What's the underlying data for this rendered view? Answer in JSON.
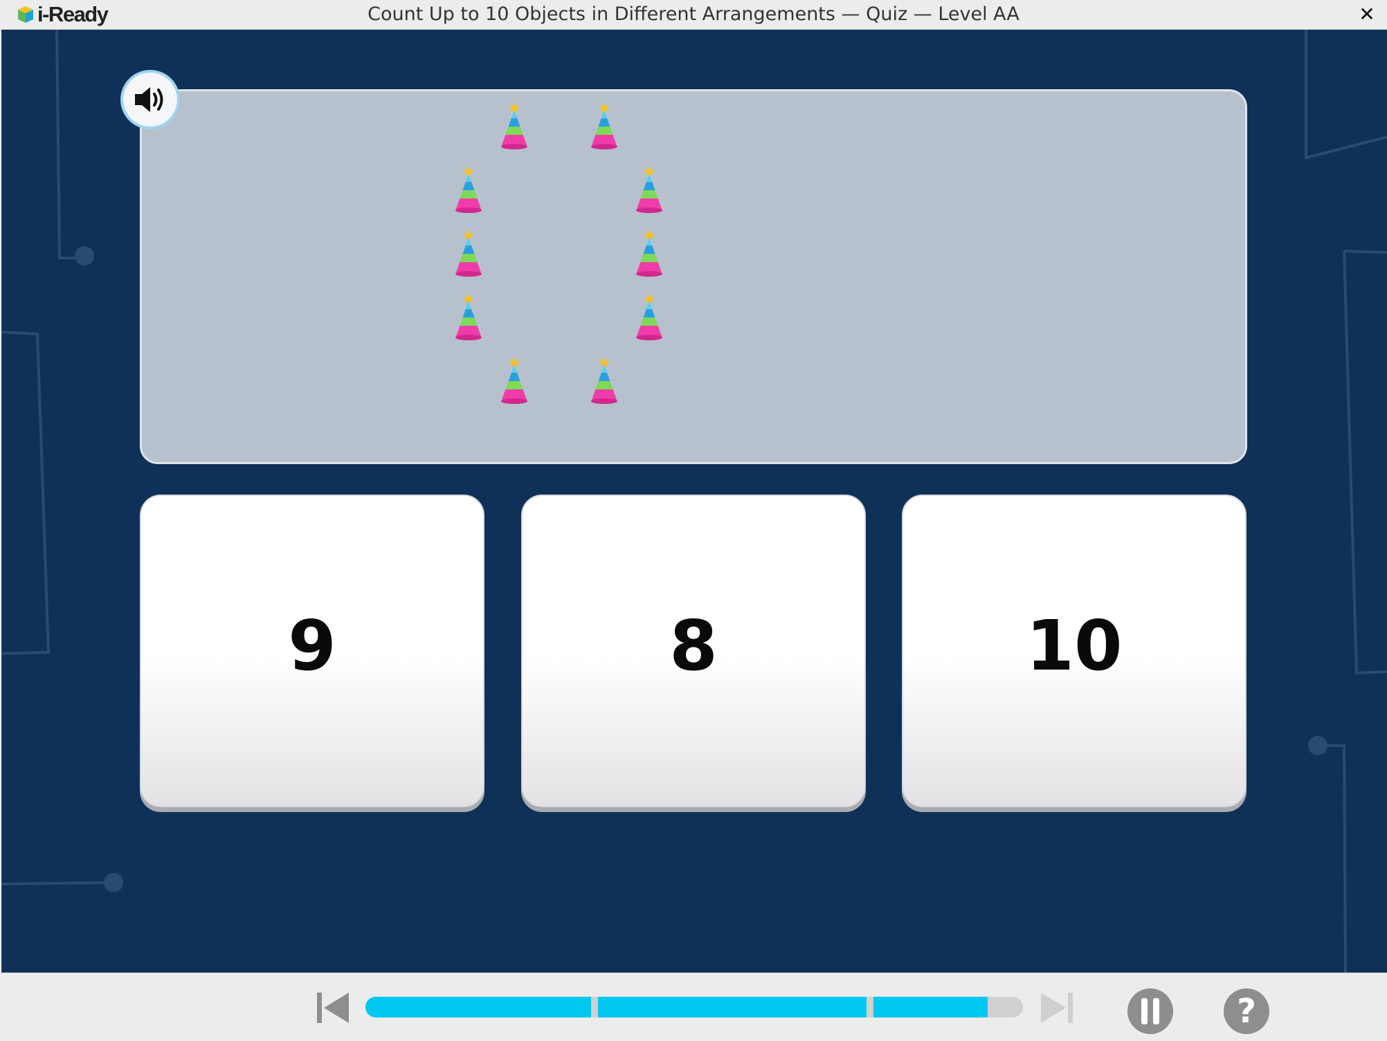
{
  "app": {
    "logo_text": "i-Ready",
    "window_title": "Count Up to 10 Objects in Different Arrangements — Quiz — Level AA",
    "close_symbol": "✕"
  },
  "question": {
    "audio_icon": "speaker-icon",
    "object_icon": "party-hat-icon",
    "object_count": 10,
    "arrangement": "oval"
  },
  "answers": [
    {
      "label": "9"
    },
    {
      "label": "8"
    },
    {
      "label": "10"
    }
  ],
  "toolbar": {
    "back_icon": "skip-back-icon",
    "forward_icon": "skip-forward-icon",
    "pause_icon": "pause-icon",
    "help_label": "?",
    "progress_segments_complete": 2,
    "progress_current_segment_fraction": 0.7,
    "progress_total_segments": 3
  },
  "colors": {
    "stage_bg": "#0f3157",
    "panel_bg": "#b7c1ce",
    "progress_fill": "#00c8f0",
    "progress_track": "#d0d0d0",
    "toolbar_icon": "#8e8e8e"
  }
}
